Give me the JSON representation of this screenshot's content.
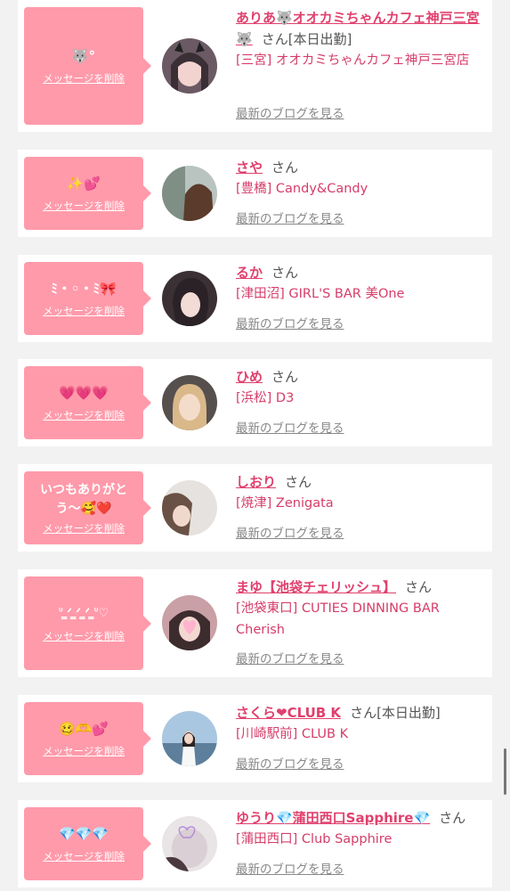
{
  "delete_label": "メッセージを削除",
  "blog_label": "最新のブログを見る",
  "san_label": "さん",
  "colors": {
    "bubble": "#ff9aaa",
    "name": "#e0406d",
    "shop": "#d63d6a",
    "background": "#f2f2f2"
  },
  "cards": [
    {
      "message": "🐺°",
      "name": "ありあ🐺オオカミちゃんカフェ神戸三宮🐺",
      "status": "[本日出勤]",
      "shop": "[三宮] オオカミちゃんカフェ神戸三宮店",
      "avatar": "avatar-photo-ariya"
    },
    {
      "message": "✨💕",
      "name": "さや",
      "status": "",
      "shop": "[豊橋] Candy&Candy",
      "avatar": "avatar-photo-saya"
    },
    {
      "message": "ﾐ・◦・ﾐ🎀",
      "name": "るか",
      "status": "",
      "shop": "[津田沼] GIRL'S BAR 美One",
      "avatar": "avatar-photo-ruka"
    },
    {
      "message": "💗💗💗",
      "name": "ひめ",
      "status": "",
      "shop": "[浜松] D3",
      "avatar": "avatar-photo-hime"
    },
    {
      "message": "いつもありがとう〜🥰❤️",
      "name": "しおり",
      "status": "",
      "shop": "[焼津] Zenigata",
      "avatar": "avatar-photo-shiori"
    },
    {
      "message": "ᐡ ̳ᐟ ̳ᐟ ̳ᐟ ̳ᐡ♡",
      "name": "まゆ【池袋チェリッシュ】",
      "status": "",
      "shop": "[池袋東口] CUTIES DINNING BAR Cherish",
      "avatar": "avatar-photo-mayu"
    },
    {
      "message": "🥴🫶💕",
      "name": "さくら❤CLUB K",
      "status": "[本日出勤]",
      "shop": "[川崎駅前] CLUB K",
      "avatar": "avatar-photo-sakura"
    },
    {
      "message": "💎💎💎",
      "name": "ゆうり💎蒲田西口Sapphire💎",
      "status": "",
      "shop": "[蒲田西口] Club Sapphire",
      "avatar": "avatar-photo-yuuri"
    }
  ]
}
